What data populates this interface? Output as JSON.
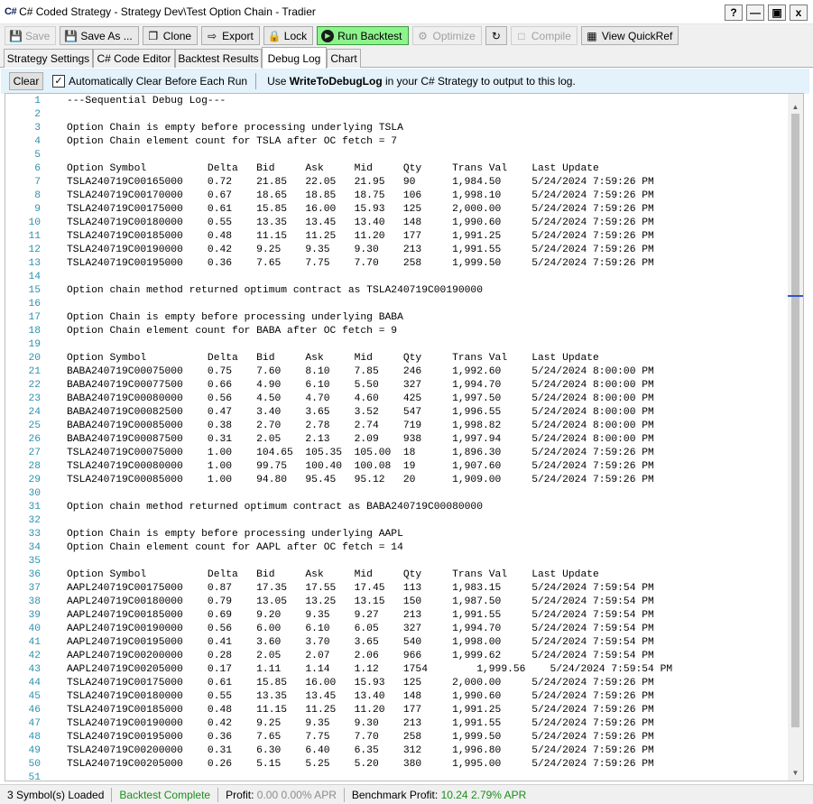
{
  "window": {
    "app_logo": "C#",
    "title": "C# Coded Strategy - Strategy Dev\\Test Option Chain - Tradier",
    "help_label": "?",
    "minimize_label": "—",
    "maximize_label": "▣",
    "close_label": "x"
  },
  "toolbar": {
    "save": "Save",
    "save_as": "Save As ...",
    "clone": "Clone",
    "export": "Export",
    "lock": "Lock",
    "run_backtest": "Run Backtest",
    "optimize": "Optimize",
    "compile": "Compile",
    "view_quickref": "View QuickRef"
  },
  "tabs": [
    {
      "label": "Strategy Settings",
      "active": false
    },
    {
      "label": "C# Code Editor",
      "active": false
    },
    {
      "label": "Backtest Results",
      "active": false
    },
    {
      "label": "Debug Log",
      "active": true
    },
    {
      "label": "Chart",
      "active": false
    }
  ],
  "debug_options": {
    "clear_label": "Clear",
    "auto_clear_checked": true,
    "auto_clear_label": "Automatically Clear Before Each Run",
    "hint_prefix": "Use ",
    "hint_bold": "WriteToDebugLog",
    "hint_suffix": " in your C# Strategy to output to this log."
  },
  "log_lines": [
    "---Sequential Debug Log---",
    "",
    "Option Chain is empty before processing underlying TSLA",
    "Option Chain element count for TSLA after OC fetch = 7",
    "",
    "Option Symbol          Delta   Bid     Ask     Mid     Qty     Trans Val    Last Update",
    "TSLA240719C00165000    0.72    21.85   22.05   21.95   90      1,984.50     5/24/2024 7:59:26 PM",
    "TSLA240719C00170000    0.67    18.65   18.85   18.75   106     1,998.10     5/24/2024 7:59:26 PM",
    "TSLA240719C00175000    0.61    15.85   16.00   15.93   125     2,000.00     5/24/2024 7:59:26 PM",
    "TSLA240719C00180000    0.55    13.35   13.45   13.40   148     1,990.60     5/24/2024 7:59:26 PM",
    "TSLA240719C00185000    0.48    11.15   11.25   11.20   177     1,991.25     5/24/2024 7:59:26 PM",
    "TSLA240719C00190000    0.42    9.25    9.35    9.30    213     1,991.55     5/24/2024 7:59:26 PM",
    "TSLA240719C00195000    0.36    7.65    7.75    7.70    258     1,999.50     5/24/2024 7:59:26 PM",
    "",
    "Option chain method returned optimum contract as TSLA240719C00190000",
    "",
    "Option Chain is empty before processing underlying BABA",
    "Option Chain element count for BABA after OC fetch = 9",
    "",
    "Option Symbol          Delta   Bid     Ask     Mid     Qty     Trans Val    Last Update",
    "BABA240719C00075000    0.75    7.60    8.10    7.85    246     1,992.60     5/24/2024 8:00:00 PM",
    "BABA240719C00077500    0.66    4.90    6.10    5.50    327     1,994.70     5/24/2024 8:00:00 PM",
    "BABA240719C00080000    0.56    4.50    4.70    4.60    425     1,997.50     5/24/2024 8:00:00 PM",
    "BABA240719C00082500    0.47    3.40    3.65    3.52    547     1,996.55     5/24/2024 8:00:00 PM",
    "BABA240719C00085000    0.38    2.70    2.78    2.74    719     1,998.82     5/24/2024 8:00:00 PM",
    "BABA240719C00087500    0.31    2.05    2.13    2.09    938     1,997.94     5/24/2024 8:00:00 PM",
    "TSLA240719C00075000    1.00    104.65  105.35  105.00  18      1,896.30     5/24/2024 7:59:26 PM",
    "TSLA240719C00080000    1.00    99.75   100.40  100.08  19      1,907.60     5/24/2024 7:59:26 PM",
    "TSLA240719C00085000    1.00    94.80   95.45   95.12   20      1,909.00     5/24/2024 7:59:26 PM",
    "",
    "Option chain method returned optimum contract as BABA240719C00080000",
    "",
    "Option Chain is empty before processing underlying AAPL",
    "Option Chain element count for AAPL after OC fetch = 14",
    "",
    "Option Symbol          Delta   Bid     Ask     Mid     Qty     Trans Val    Last Update",
    "AAPL240719C00175000    0.87    17.35   17.55   17.45   113     1,983.15     5/24/2024 7:59:54 PM",
    "AAPL240719C00180000    0.79    13.05   13.25   13.15   150     1,987.50     5/24/2024 7:59:54 PM",
    "AAPL240719C00185000    0.69    9.20    9.35    9.27    213     1,991.55     5/24/2024 7:59:54 PM",
    "AAPL240719C00190000    0.56    6.00    6.10    6.05    327     1,994.70     5/24/2024 7:59:54 PM",
    "AAPL240719C00195000    0.41    3.60    3.70    3.65    540     1,998.00     5/24/2024 7:59:54 PM",
    "AAPL240719C00200000    0.28    2.05    2.07    2.06    966     1,999.62     5/24/2024 7:59:54 PM",
    "AAPL240719C00205000    0.17    1.11    1.14    1.12    1754        1,999.56    5/24/2024 7:59:54 PM",
    "TSLA240719C00175000    0.61    15.85   16.00   15.93   125     2,000.00     5/24/2024 7:59:26 PM",
    "TSLA240719C00180000    0.55    13.35   13.45   13.40   148     1,990.60     5/24/2024 7:59:26 PM",
    "TSLA240719C00185000    0.48    11.15   11.25   11.20   177     1,991.25     5/24/2024 7:59:26 PM",
    "TSLA240719C00190000    0.42    9.25    9.35    9.30    213     1,991.55     5/24/2024 7:59:26 PM",
    "TSLA240719C00195000    0.36    7.65    7.75    7.70    258     1,999.50     5/24/2024 7:59:26 PM",
    "TSLA240719C00200000    0.31    6.30    6.40    6.35    312     1,996.80     5/24/2024 7:59:26 PM",
    "TSLA240719C00205000    0.26    5.15    5.25    5.20    380     1,995.00     5/24/2024 7:59:26 PM",
    ""
  ],
  "status": {
    "symbols_loaded": "3 Symbol(s) Loaded",
    "backtest_state": "Backtest Complete",
    "profit_label": "Profit:",
    "profit_value": "0.00 0.00% APR",
    "benchmark_label": "Benchmark Profit:",
    "benchmark_value": "10.24 2.79% APR"
  },
  "colors": {
    "run_button": "#8df48d",
    "line_number": "#2b91af",
    "options_bar": "#e3f2fb",
    "status_green": "#1a8f1a"
  }
}
